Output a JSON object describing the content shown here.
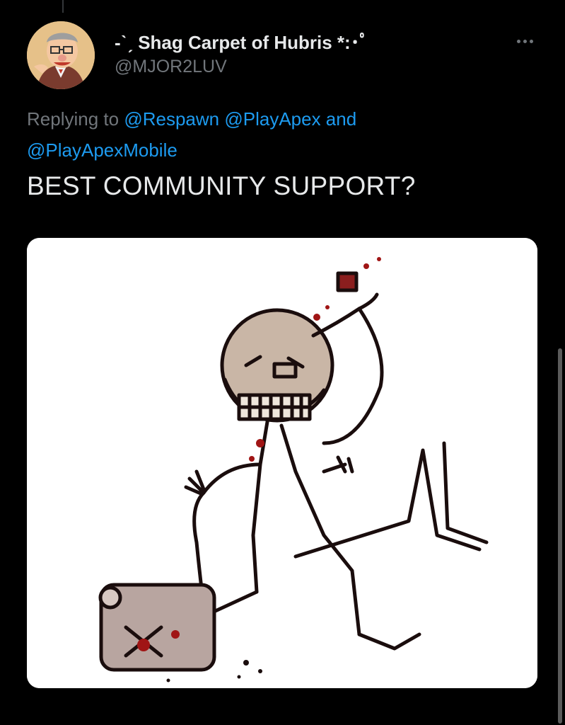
{
  "tweet": {
    "display_name": "-ˋˏ Shag Carpet of Hubris *:･ﾟ",
    "handle": "@MJOR2LUV",
    "reply_prefix": "Replying to ",
    "reply_targets": [
      "@Respawn",
      "@PlayApex",
      "@PlayApexMobile"
    ],
    "reply_joiner": " and",
    "text": "BEST COMMUNITY SUPPORT?"
  },
  "icons": {
    "more": "more-horizontal-icon"
  },
  "colors": {
    "background": "#000000",
    "primary_text": "#e7e9ea",
    "secondary_text": "#71767b",
    "link": "#1d9bf0"
  }
}
